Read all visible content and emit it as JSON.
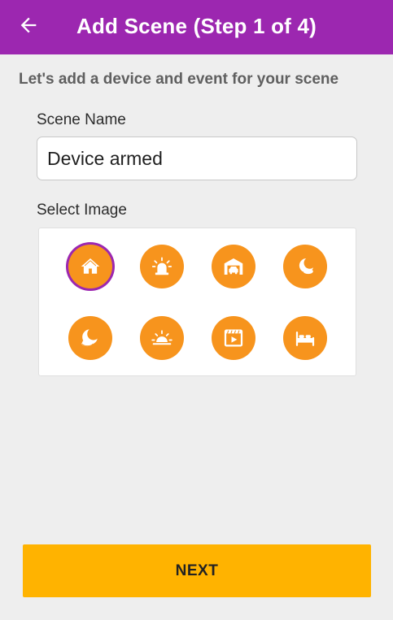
{
  "appbar": {
    "back_icon": "arrow-left-icon",
    "title": "Add Scene (Step 1 of 4)",
    "color": "#9c27b0"
  },
  "heading": "Let's add a device and event for your scene",
  "scene_name": {
    "label": "Scene Name",
    "value": "Device armed"
  },
  "select_image": {
    "label": "Select Image",
    "accent": "#f7941d",
    "options": [
      {
        "icon": "home-icon",
        "selected": true
      },
      {
        "icon": "alarm-siren-icon",
        "selected": false
      },
      {
        "icon": "garage-car-icon",
        "selected": false
      },
      {
        "icon": "moon-clouds-icon",
        "selected": false
      },
      {
        "icon": "moon-clouds-night-icon",
        "selected": false
      },
      {
        "icon": "sunrise-icon",
        "selected": false
      },
      {
        "icon": "movie-play-icon",
        "selected": false
      },
      {
        "icon": "bed-icon",
        "selected": false
      }
    ]
  },
  "next_button": {
    "label": "NEXT",
    "color": "#ffb300"
  }
}
